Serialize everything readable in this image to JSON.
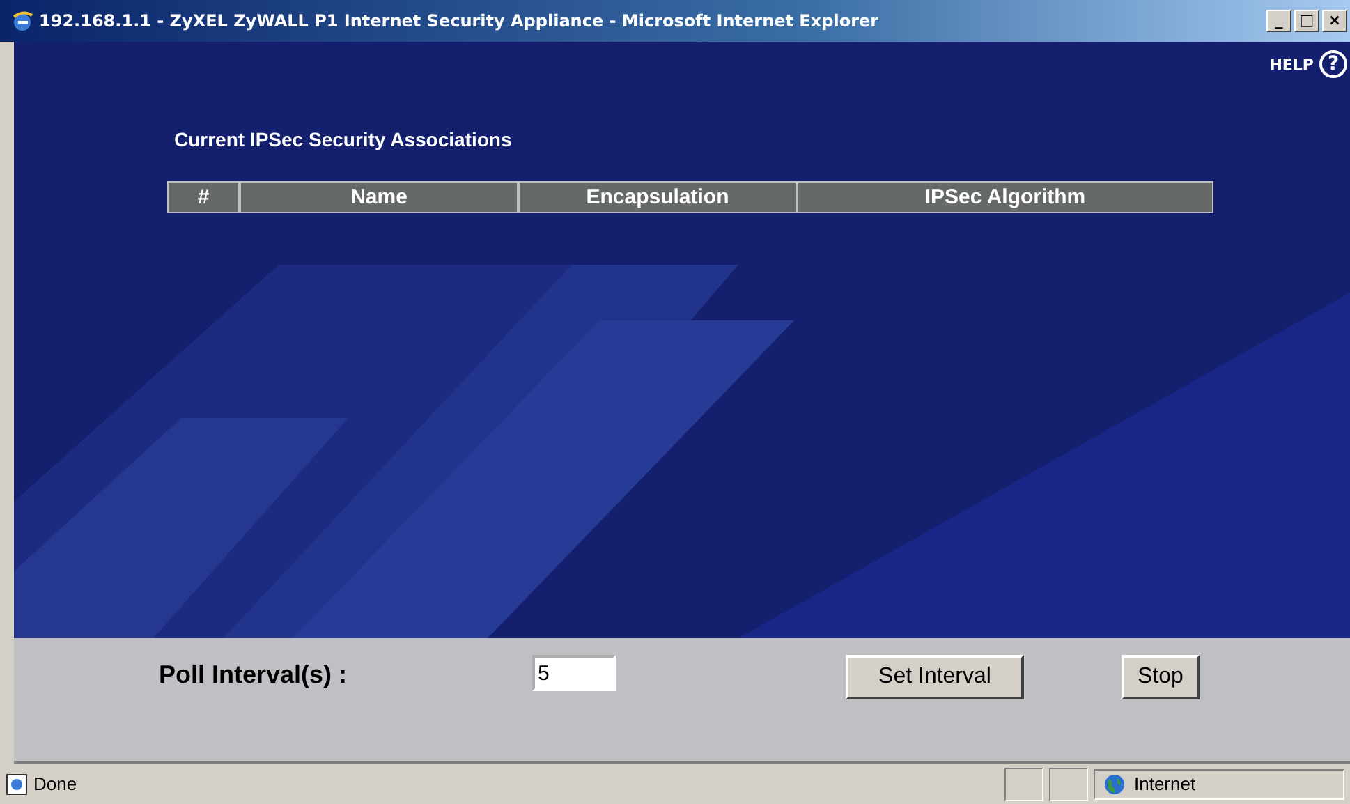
{
  "window": {
    "title": "192.168.1.1 - ZyXEL ZyWALL P1 Internet Security Appliance - Microsoft Internet Explorer",
    "controls": [
      "_",
      "□",
      "×"
    ]
  },
  "help": {
    "label": "HELP",
    "icon": "?"
  },
  "section_title": "Current IPSec Security Associations",
  "table": {
    "columns": [
      "#",
      "Name",
      "Encapsulation",
      "IPSec Algorithm"
    ]
  },
  "poll": {
    "label": "Poll Interval(s) :",
    "value": "5"
  },
  "buttons": [
    "Set Interval",
    "Stop"
  ],
  "status_bar": {
    "text": "Done",
    "zone": "Internet"
  }
}
